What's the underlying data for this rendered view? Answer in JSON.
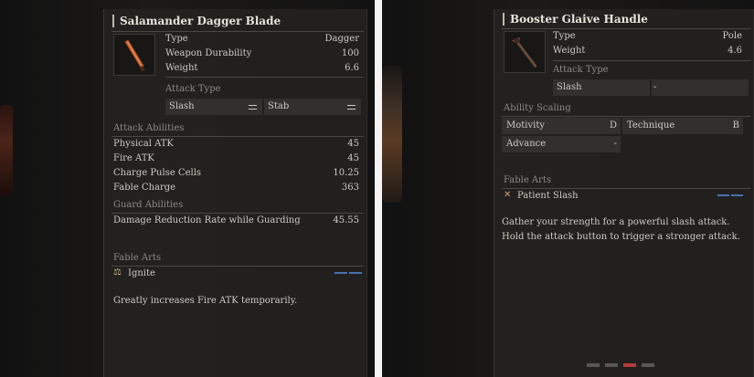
{
  "left_card": {
    "title": "Salamander Dagger Blade",
    "icon": "dagger-blade-icon",
    "info": [
      {
        "label": "Type",
        "value": "Dagger"
      },
      {
        "label": "Weapon Durability",
        "value": "100"
      },
      {
        "label": "Weight",
        "value": "6.6"
      }
    ],
    "attack_type_label": "Attack Type",
    "attack_types": [
      "Slash",
      "Stab"
    ],
    "attack_abilities_label": "Attack Abilities",
    "attack_abilities": [
      {
        "label": "Physical ATK",
        "value": "45"
      },
      {
        "label": "Fire ATK",
        "value": "45"
      },
      {
        "label": "Charge Pulse Cells",
        "value": "10.25"
      },
      {
        "label": "Fable Charge",
        "value": "363"
      }
    ],
    "guard_abilities_label": "Guard Abilities",
    "guard_abilities": [
      {
        "label": "Damage Reduction Rate while Guarding",
        "value": "45.55"
      }
    ],
    "fable_arts_label": "Fable Arts",
    "fable_art": {
      "icon": "scales-icon",
      "name": "Ignite"
    },
    "description": "Greatly increases Fire ATK temporarily."
  },
  "right_card": {
    "title": "Booster Glaive Handle",
    "icon": "glaive-handle-icon",
    "info": [
      {
        "label": "Type",
        "value": "Pole"
      },
      {
        "label": "Weight",
        "value": "4.6"
      }
    ],
    "attack_type_label": "Attack Type",
    "attack_types": [
      "Slash",
      "-"
    ],
    "ability_scaling_label": "Ability Scaling",
    "scaling": [
      {
        "label": "Motivity",
        "value": "D"
      },
      {
        "label": "Technique",
        "value": "B"
      },
      {
        "label": "Advance",
        "value": "-"
      }
    ],
    "fable_arts_label": "Fable Arts",
    "fable_art": {
      "icon": "crossed-swords-icon",
      "name": "Patient Slash"
    },
    "description_lines": [
      "Gather your strength for a powerful slash attack.",
      "Hold the attack button to trigger a stronger attack."
    ],
    "pager": {
      "count": 4,
      "active_index": 2
    }
  },
  "colors": {
    "accent_blue": "#4b6fb0",
    "pager_active": "#b43a3a",
    "panel_bg": "#222120"
  }
}
